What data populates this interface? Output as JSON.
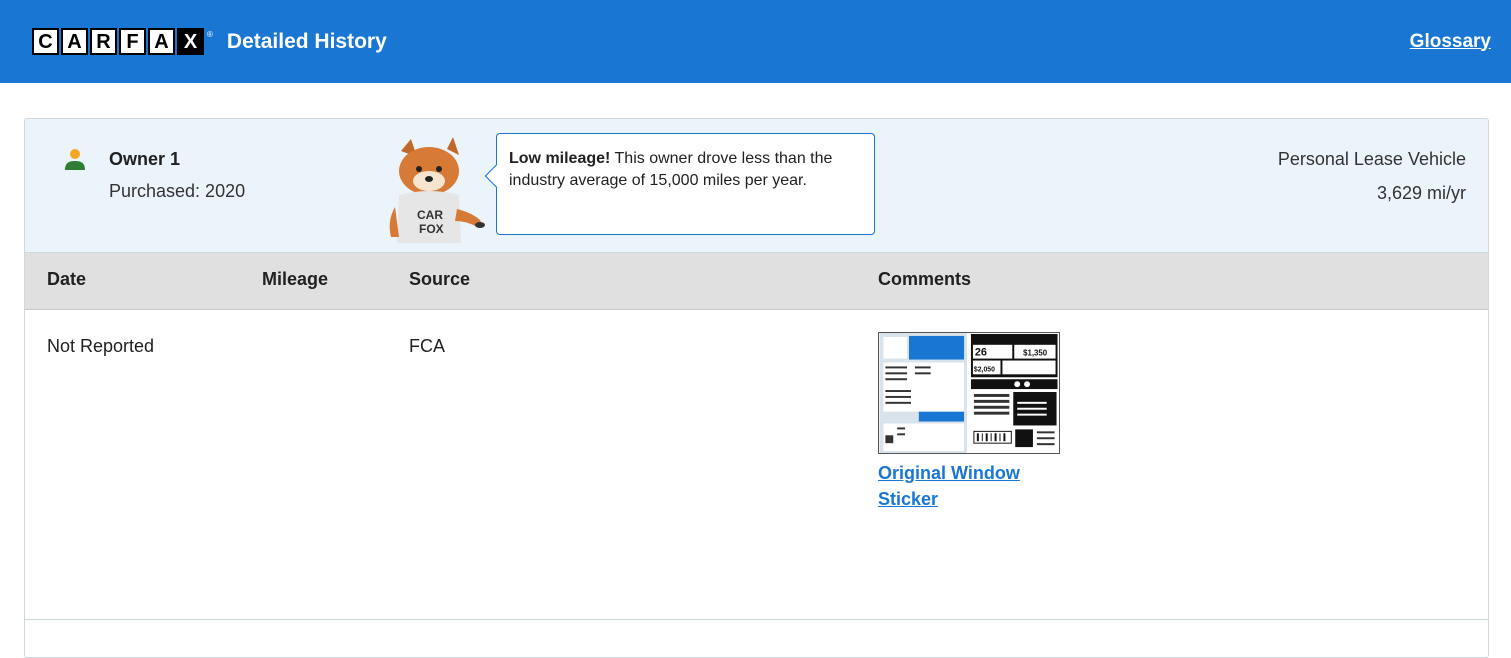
{
  "header": {
    "logo_letters": [
      "C",
      "A",
      "R",
      "F",
      "A",
      "X"
    ],
    "title": "Detailed History",
    "glossary_link": "Glossary",
    "brand_color": "#1976d2"
  },
  "owner": {
    "icon": "person-icon",
    "name": "Owner 1",
    "purchased": "Purchased: 2020",
    "tip_bold": "Low mileage!",
    "tip_text": " This owner drove less than the industry average of 15,000 miles per year.",
    "vehicle_type": "Personal Lease Vehicle",
    "miles_per_year": "3,629 mi/yr"
  },
  "table": {
    "columns": [
      "Date",
      "Mileage",
      "Source",
      "Comments"
    ],
    "rows": [
      {
        "date": "Not Reported",
        "mileage": "",
        "source": "FCA",
        "comment_link": "Original Window Sticker"
      }
    ]
  }
}
